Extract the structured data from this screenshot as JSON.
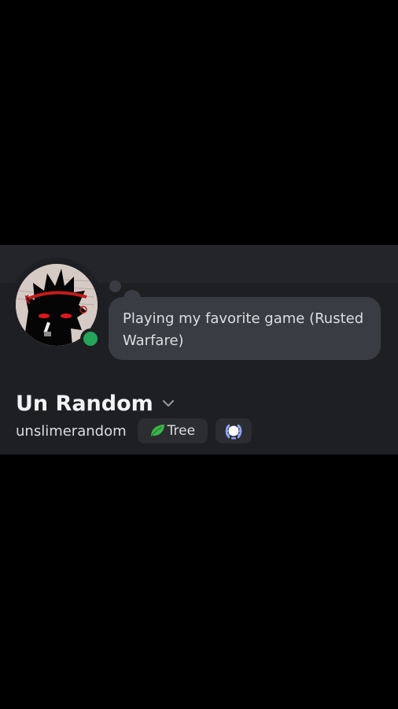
{
  "profile": {
    "custom_status": "Playing my favorite game (Rusted Warfare)",
    "display_name": "Un Random",
    "username": "unslimerandom",
    "guild_tag": {
      "icon": "leaf-icon",
      "label": "Tree"
    },
    "badge_icon": "laurel-badge-icon",
    "presence": "online",
    "colors": {
      "card_bg": "#1e1f22",
      "bubble_bg": "#3a3c43",
      "online": "#23a55a",
      "badge_bg": "#2b2d31"
    }
  }
}
